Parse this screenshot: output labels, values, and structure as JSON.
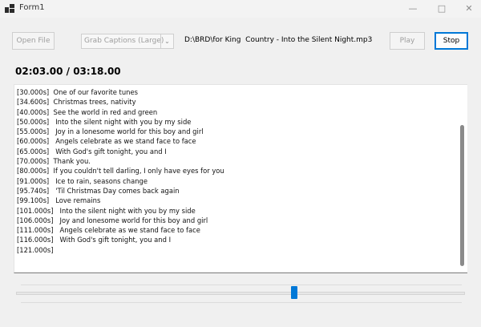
{
  "window": {
    "title": "Form1",
    "minimize_icon": "minimize-icon",
    "maximize_icon": "maximize-icon",
    "close_icon": "close-icon"
  },
  "toolbar": {
    "open_file_label": "Open File",
    "caption_mode": "Grab Captions (Large)",
    "file_path": "D:\\BRD\\for King  Country - Into the Silent Night.mp3",
    "play_label": "Play",
    "stop_label": "Stop"
  },
  "player": {
    "time_display": "02:03.00 / 03:18.00",
    "position_seconds": 123,
    "duration_seconds": 198
  },
  "captions": [
    "[30.000s]  One of our favorite tunes",
    "[34.600s]  Christmas trees, nativity",
    "[40.000s]  See the world in red and green",
    "[50.000s]   Into the silent night with you by my side",
    "[55.000s]   Joy in a lonesome world for this boy and girl",
    "[60.000s]   Angels celebrate as we stand face to face",
    "[65.000s]   With God's gift tonight, you and I",
    "[70.000s]  Thank you.",
    "[80.000s]  If you couldn't tell darling, I only have eyes for you",
    "[91.000s]   Ice to rain, seasons change",
    "[95.740s]   'Til Christmas Day comes back again",
    "[99.100s]   Love remains",
    "[101.000s]   Into the silent night with you by my side",
    "[106.000s]   Joy and lonesome world for this boy and girl",
    "[111.000s]   Angels celebrate as we stand face to face",
    "[116.000s]   With God's gift tonight, you and I",
    "[121.000s]"
  ]
}
